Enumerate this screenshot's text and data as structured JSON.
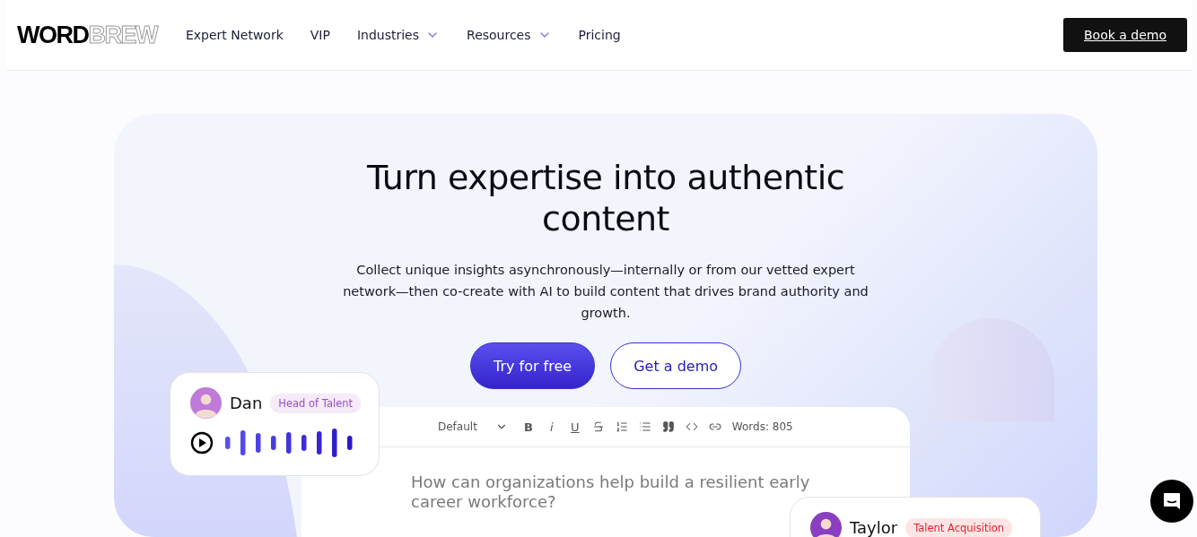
{
  "header": {
    "logo": {
      "bold": "WORD",
      "outline": "BREW"
    },
    "nav": [
      {
        "label": "Expert Network",
        "has_menu": false
      },
      {
        "label": "VIP",
        "has_menu": false
      },
      {
        "label": "Industries",
        "has_menu": true
      },
      {
        "label": "Resources",
        "has_menu": true
      },
      {
        "label": "Pricing",
        "has_menu": false
      }
    ],
    "cta": "Book a demo"
  },
  "hero": {
    "title": "Turn expertise into authentic content",
    "subtitle": "Collect unique insights asynchronously—internally or from our vetted expert network—then co-create with AI to build content that drives brand authority and growth.",
    "buttons": [
      {
        "label": "Try for free",
        "kind": "primary"
      },
      {
        "label": "Get a demo",
        "kind": "outline"
      }
    ]
  },
  "voice_card": {
    "name": "Dan",
    "role": "Head of Talent"
  },
  "editor": {
    "style_select": "Default",
    "tools": [
      {
        "kind": "text",
        "label": "B"
      },
      {
        "kind": "text",
        "label": "i"
      },
      {
        "kind": "text",
        "label": "U"
      },
      {
        "kind": "strike"
      },
      {
        "kind": "ordered"
      },
      {
        "kind": "bullets"
      },
      {
        "kind": "quote"
      },
      {
        "kind": "code"
      },
      {
        "kind": "link"
      }
    ],
    "word_count": "Words: 805",
    "question": "How can organizations help build a resilient early career workforce?"
  },
  "profile_card": {
    "name": "Taylor",
    "role": "Talent Acquisition"
  }
}
